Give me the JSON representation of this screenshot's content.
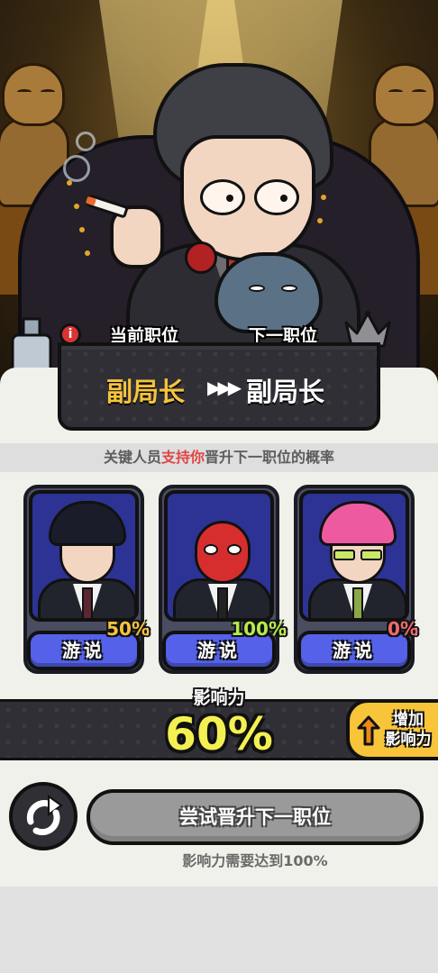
{
  "position": {
    "current_label": "当前职位",
    "next_label": "下一职位",
    "current": "副局长",
    "next": "副局长",
    "arrows": "▶▶▶"
  },
  "probability": {
    "prefix": "关键人员",
    "highlight": "支持你",
    "suffix": "晋升下一职位的概率"
  },
  "people": [
    {
      "action": "游说",
      "percent": "50%",
      "percent_color": "#f6c33e"
    },
    {
      "action": "游说",
      "percent": "100%",
      "percent_color": "#b6ec4a"
    },
    {
      "action": "游说",
      "percent": "0%",
      "percent_color": "#f36a6a"
    }
  ],
  "influence": {
    "label": "影响力",
    "value": "60%"
  },
  "add_influence": {
    "line1": "增加",
    "line2": "影响力"
  },
  "promote": {
    "button": "尝试晋升下一职位",
    "hint": "影响力需要达到100%"
  },
  "icons": {
    "info": "i"
  }
}
